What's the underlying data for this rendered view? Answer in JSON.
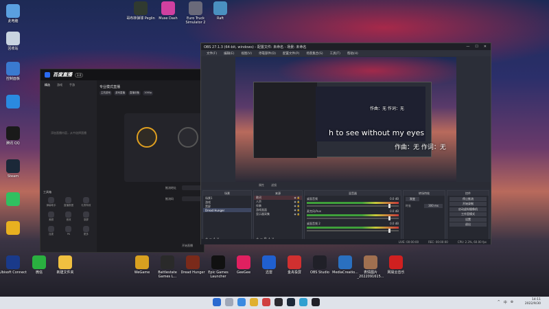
{
  "desktop_left": [
    {
      "label": "此电脑",
      "color": "#5aa0e0"
    },
    {
      "label": "回收站",
      "color": "#c8d4e0"
    },
    {
      "label": "控制面板",
      "color": "#3a7ad0"
    },
    {
      "label": "",
      "color": "#2a8ae0"
    },
    {
      "label": "腾讯 QQ",
      "color": "#1a1a1a"
    },
    {
      "label": "Steam",
      "color": "#1b2838"
    },
    {
      "label": "",
      "color": "#30c060"
    },
    {
      "label": "",
      "color": "#e8b020"
    },
    {
      "label": "Ubisoft Connect",
      "color": "#1a3a8a"
    },
    {
      "label": "微信",
      "color": "#2ab040"
    },
    {
      "label": "新建文件夹",
      "color": "#f0c040"
    }
  ],
  "desktop_top": [
    {
      "label": "哥布林弹球 Peglin",
      "color": "#303a30"
    },
    {
      "label": "Muse Dash",
      "color": "#d040a0"
    },
    {
      "label": "Euro Truck Simulator 2",
      "color": "#6a6a7a"
    },
    {
      "label": "Raft",
      "color": "#4a90c0"
    }
  ],
  "desktop_bottom": [
    {
      "label": "WeGame",
      "color": "#d8a020"
    },
    {
      "label": "Battlestate Games L...",
      "color": "#2a2a2a"
    },
    {
      "label": "Dread Hunger",
      "color": "#7a2a1a"
    },
    {
      "label": "Epic Games Launcher",
      "color": "#111111"
    },
    {
      "label": "GeeGee",
      "color": "#e02060"
    },
    {
      "label": "迅雷",
      "color": "#2060d0"
    },
    {
      "label": "金舟投屏",
      "color": "#d03030"
    },
    {
      "label": "OBS Studio",
      "color": "#202028"
    },
    {
      "label": "MediaCreatio...",
      "color": "#2a70c0"
    },
    {
      "label": "表情图片 _2022091615...",
      "color": "#a07050"
    },
    {
      "label": "网易云音乐",
      "color": "#d02020"
    }
  ],
  "streaming_app": {
    "brand": "百度直播",
    "version": "3.0",
    "tabs": [
      "精选",
      "游戏",
      "手游"
    ],
    "mode_title": "专业模式直播",
    "chips": [
      "主机游戏",
      "游戏直播",
      "直播设备",
      "1080p"
    ],
    "sidebar_hint": "添加直播内容，从中选择直播",
    "tools_label": "工具箱",
    "tools": [
      "弹幕助手",
      "直播数据",
      "礼物特效",
      "美颜",
      "音效",
      "录屏",
      "连麦",
      "PK",
      "更多"
    ],
    "field1_label": "推流地址",
    "field2_label": "推流码",
    "start_label": "开始直播"
  },
  "obs": {
    "title": "OBS 27.1.3 (64-bit, windows) - 配置文件: 未命名 - 场景: 未命名",
    "window_controls": [
      "—",
      "☐",
      "✕"
    ],
    "menu": [
      "文件(F)",
      "编辑(E)",
      "视图(V)",
      "停靠部件(D)",
      "配置文件(P)",
      "场景集合(S)",
      "工具(T)",
      "帮助(H)"
    ],
    "lyric_small": "作曲：无 作词：无",
    "lyric_line1": "h to see without my eyes",
    "lyric_line2": "作曲：无 作词：无",
    "preview_toolbar": [
      "属性",
      "滤镜"
    ],
    "panels": {
      "scenes": {
        "header": "场景",
        "items": [
          "场景1",
          "游戏",
          "黑屏",
          "Dread Hunger"
        ],
        "active": 3
      },
      "sources": {
        "header": "来源",
        "items": [
          "歌词",
          "人声",
          "伴奏",
          "游戏画面",
          "显示器采集"
        ],
        "active": 0
      },
      "mixer": {
        "header": "混音器",
        "channels": [
          {
            "name": "桌面音频",
            "db": "0.0 dB"
          },
          {
            "name": "麦克风/Aux",
            "db": "0.0 dB"
          },
          {
            "name": "桌面音频 2",
            "db": "0.0 dB"
          }
        ]
      },
      "transitions": {
        "header": "转场特效",
        "type": "渐变",
        "duration_label": "时长",
        "duration": "300 ms"
      },
      "controls": {
        "header": "控件",
        "buttons": [
          "停止推流",
          "开始录制",
          "启动虚拟摄像机",
          "工作室模式",
          "设置",
          "退出"
        ]
      }
    },
    "status": {
      "live": "LIVE: 00:00:00",
      "rec": "REC: 00:00:00",
      "cpu": "CPU: 2.3%, 60.00 fps"
    }
  },
  "taskbar": {
    "time": "14:11",
    "date": "2022/9/30",
    "tray": [
      "^",
      "中",
      "⊕"
    ]
  }
}
